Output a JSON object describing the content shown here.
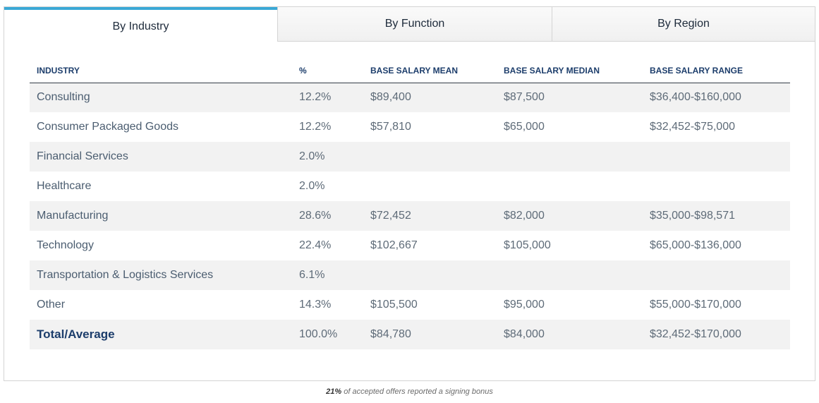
{
  "tabs": [
    {
      "label": "By Industry",
      "active": true
    },
    {
      "label": "By Function",
      "active": false
    },
    {
      "label": "By Region",
      "active": false
    }
  ],
  "table": {
    "headers": [
      "INDUSTRY",
      "%",
      "BASE SALARY MEAN",
      "BASE SALARY MEDIAN",
      "BASE SALARY RANGE"
    ],
    "rows": [
      [
        "Consulting",
        "12.2%",
        "$89,400",
        "$87,500",
        "$36,400-$160,000"
      ],
      [
        "Consumer Packaged Goods",
        "12.2%",
        "$57,810",
        "$65,000",
        "$32,452-$75,000"
      ],
      [
        "Financial Services",
        "2.0%",
        "",
        "",
        ""
      ],
      [
        "Healthcare",
        "2.0%",
        "",
        "",
        ""
      ],
      [
        "Manufacturing",
        "28.6%",
        "$72,452",
        "$82,000",
        "$35,000-$98,571"
      ],
      [
        "Technology",
        "22.4%",
        "$102,667",
        "$105,000",
        "$65,000-$136,000"
      ],
      [
        "Transportation & Logistics Services",
        "6.1%",
        "",
        "",
        ""
      ],
      [
        "Other",
        "14.3%",
        "$105,500",
        "$95,000",
        "$55,000-$170,000"
      ],
      [
        "Total/Average",
        "100.0%",
        "$84,780",
        "$84,000",
        "$32,452-$170,000"
      ]
    ]
  },
  "footnote": {
    "highlight": "21%",
    "text": " of accepted offers reported a signing bonus"
  },
  "colors": {
    "accent": "#3aa8d6",
    "header_text": "#1c3d6b",
    "row_stripe": "#f2f2f2"
  }
}
